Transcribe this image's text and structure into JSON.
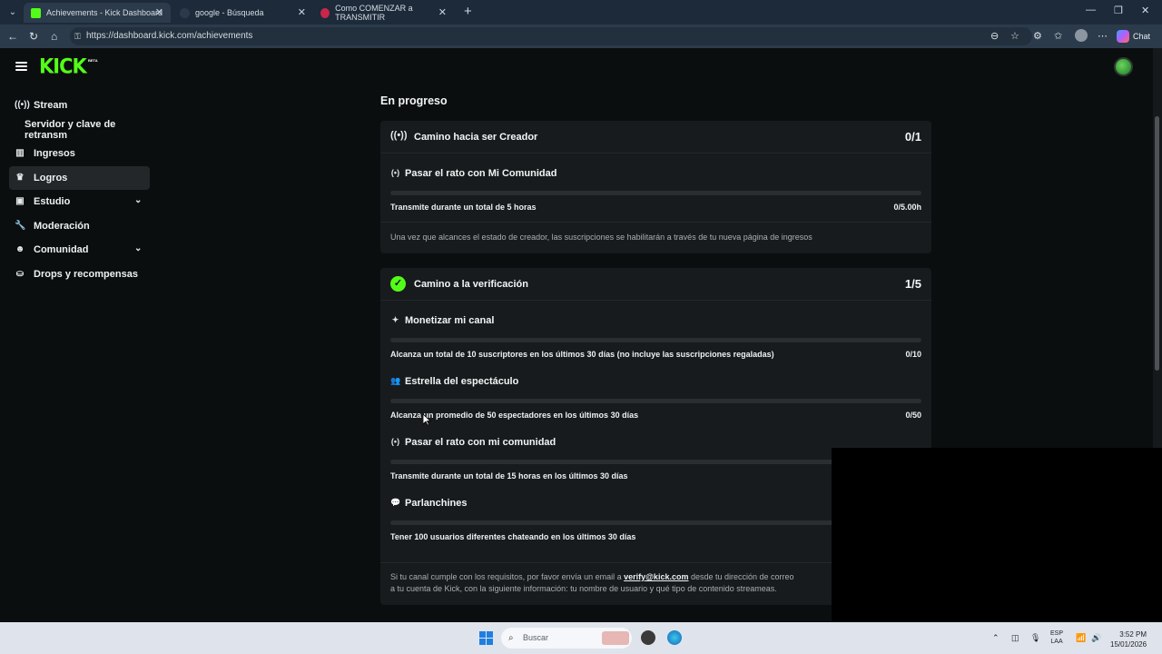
{
  "browser": {
    "tabs": [
      {
        "title": "Achievements - Kick Dashboard",
        "active": true
      },
      {
        "title": "google - Búsqueda",
        "active": false
      },
      {
        "title": "Como COMENZAR a TRANSMITIR",
        "active": false
      }
    ],
    "url": "https://dashboard.kick.com/achievements",
    "chat_label": "Chat"
  },
  "header": {
    "logo": "KICK",
    "badge": "BETA"
  },
  "sidebar": {
    "items": [
      {
        "label": "Stream",
        "icon": "broadcast-icon"
      },
      {
        "label": "Servidor y clave de retransm",
        "icon": ""
      },
      {
        "label": "Ingresos",
        "icon": "chart-icon"
      },
      {
        "label": "Logros",
        "icon": "trophy-icon",
        "active": true
      },
      {
        "label": "Estudio",
        "icon": "studio-icon",
        "expandable": true
      },
      {
        "label": "Moderación",
        "icon": "wrench-icon"
      },
      {
        "label": "Comunidad",
        "icon": "community-icon",
        "expandable": true
      },
      {
        "label": "Drops y recompensas",
        "icon": "drops-icon"
      }
    ]
  },
  "main": {
    "section_title": "En progreso",
    "creator": {
      "title": "Camino hacia ser Creador",
      "count": "0/1",
      "requirement": {
        "title": "Pasar el rato con Mi Comunidad",
        "description": "Transmite durante un total de 5 horas",
        "value": "0/5.00h",
        "progress": 0
      },
      "footer": "Una vez que alcances el estado de creador, las suscripciones se habilitarán a través de tu nueva página de ingresos"
    },
    "verification": {
      "title": "Camino a la verificación",
      "count": "1/5",
      "requirements": [
        {
          "title": "Monetizar mi canal",
          "description": "Alcanza un total de 10 suscriptores en los últimos 30 días (no incluye las suscripciones regaladas)",
          "value": "0/10",
          "progress": 0,
          "icon": "sparkle-icon"
        },
        {
          "title": "Estrella del espectáculo",
          "description": "Alcanza un promedio de 50 espectadores en los últimos 30 días",
          "value": "0/50",
          "progress": 0,
          "icon": "users-icon"
        },
        {
          "title": "Pasar el rato con mi comunidad",
          "description": "Transmite durante un total de 15 horas en los últimos 30 días",
          "value": "",
          "progress": 0,
          "icon": "broadcast-icon"
        },
        {
          "title": "Parlanchines",
          "description": "Tener 100 usuarios diferentes chateando en los últimos 30 días",
          "value": "",
          "progress": 0,
          "icon": "chat-bubble-icon"
        }
      ],
      "footer_before": "Si tu canal cumple con los requisitos, por favor envía un email a ",
      "footer_link": "verify@kick.com",
      "footer_after": " desde tu dirección de correo",
      "footer_line2": "a tu cuenta de Kick, con la siguiente información: tu nombre de usuario y qué tipo de contenido streameas."
    }
  },
  "taskbar": {
    "search_placeholder": "Buscar",
    "lang_top": "ESP",
    "lang_bottom": "LAA",
    "time": "3:52 PM",
    "date": "15/01/2026"
  },
  "colors": {
    "accent": "#53fc18",
    "card_bg": "#181b1d",
    "page_bg": "#0b0e0f"
  }
}
